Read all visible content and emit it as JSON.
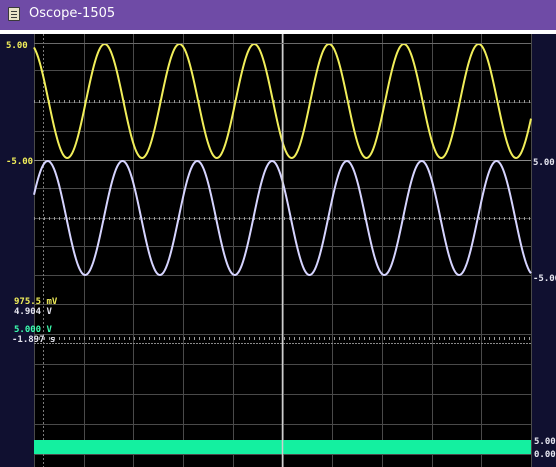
{
  "window": {
    "title": "Oscope-1505"
  },
  "channels": {
    "ch1": {
      "max_label": "5.00",
      "min_label": "-5.00",
      "color": "#f1ee5a",
      "waveform": "sine"
    },
    "ch2": {
      "max_label": "5.00",
      "min_label": "-5.00",
      "color": "#d6d4ff",
      "waveform": "sine"
    },
    "digital": {
      "high_label": "5.00",
      "low_label": "0.00",
      "color": "#14f0a0"
    }
  },
  "cursor_readouts": {
    "ch1_value": "975.5 mV",
    "ch2_value": "4.904 V",
    "digital_value": "5.000 V",
    "time_value": "-1.897 s"
  },
  "colors": {
    "titlebar": "#6f4ba6",
    "background": "#000000",
    "grid": "#4a4a4a",
    "cursor": "#cfcfcf"
  }
}
